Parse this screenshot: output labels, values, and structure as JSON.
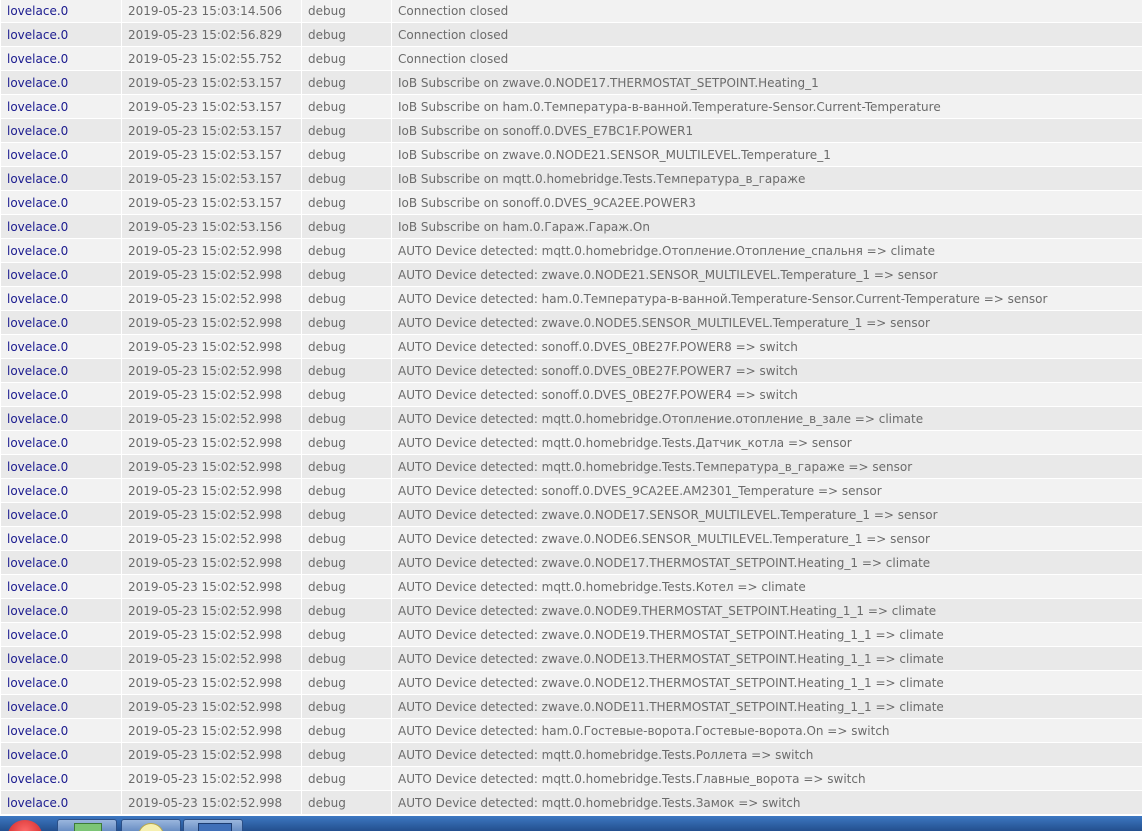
{
  "log": {
    "rows": [
      {
        "source": "lovelace.0",
        "time": "2019-05-23 15:03:14.506",
        "severity": "debug",
        "message": "Connection closed"
      },
      {
        "source": "lovelace.0",
        "time": "2019-05-23 15:02:56.829",
        "severity": "debug",
        "message": "Connection closed"
      },
      {
        "source": "lovelace.0",
        "time": "2019-05-23 15:02:55.752",
        "severity": "debug",
        "message": "Connection closed"
      },
      {
        "source": "lovelace.0",
        "time": "2019-05-23 15:02:53.157",
        "severity": "debug",
        "message": "IoB Subscribe on zwave.0.NODE17.THERMOSTAT_SETPOINT.Heating_1"
      },
      {
        "source": "lovelace.0",
        "time": "2019-05-23 15:02:53.157",
        "severity": "debug",
        "message": "IoB Subscribe on ham.0.Температура-в-ванной.Temperature-Sensor.Current-Temperature"
      },
      {
        "source": "lovelace.0",
        "time": "2019-05-23 15:02:53.157",
        "severity": "debug",
        "message": "IoB Subscribe on sonoff.0.DVES_E7BC1F.POWER1"
      },
      {
        "source": "lovelace.0",
        "time": "2019-05-23 15:02:53.157",
        "severity": "debug",
        "message": "IoB Subscribe on zwave.0.NODE21.SENSOR_MULTILEVEL.Temperature_1"
      },
      {
        "source": "lovelace.0",
        "time": "2019-05-23 15:02:53.157",
        "severity": "debug",
        "message": "IoB Subscribe on mqtt.0.homebridge.Tests.Температура_в_гараже"
      },
      {
        "source": "lovelace.0",
        "time": "2019-05-23 15:02:53.157",
        "severity": "debug",
        "message": "IoB Subscribe on sonoff.0.DVES_9CA2EE.POWER3"
      },
      {
        "source": "lovelace.0",
        "time": "2019-05-23 15:02:53.156",
        "severity": "debug",
        "message": "IoB Subscribe on ham.0.Гараж.Гараж.On"
      },
      {
        "source": "lovelace.0",
        "time": "2019-05-23 15:02:52.998",
        "severity": "debug",
        "message": "AUTO Device detected: mqtt.0.homebridge.Отопление.Отопление_спальня => climate"
      },
      {
        "source": "lovelace.0",
        "time": "2019-05-23 15:02:52.998",
        "severity": "debug",
        "message": "AUTO Device detected: zwave.0.NODE21.SENSOR_MULTILEVEL.Temperature_1 => sensor"
      },
      {
        "source": "lovelace.0",
        "time": "2019-05-23 15:02:52.998",
        "severity": "debug",
        "message": "AUTO Device detected: ham.0.Температура-в-ванной.Temperature-Sensor.Current-Temperature => sensor"
      },
      {
        "source": "lovelace.0",
        "time": "2019-05-23 15:02:52.998",
        "severity": "debug",
        "message": "AUTO Device detected: zwave.0.NODE5.SENSOR_MULTILEVEL.Temperature_1 => sensor"
      },
      {
        "source": "lovelace.0",
        "time": "2019-05-23 15:02:52.998",
        "severity": "debug",
        "message": "AUTO Device detected: sonoff.0.DVES_0BE27F.POWER8 => switch"
      },
      {
        "source": "lovelace.0",
        "time": "2019-05-23 15:02:52.998",
        "severity": "debug",
        "message": "AUTO Device detected: sonoff.0.DVES_0BE27F.POWER7 => switch"
      },
      {
        "source": "lovelace.0",
        "time": "2019-05-23 15:02:52.998",
        "severity": "debug",
        "message": "AUTO Device detected: sonoff.0.DVES_0BE27F.POWER4 => switch"
      },
      {
        "source": "lovelace.0",
        "time": "2019-05-23 15:02:52.998",
        "severity": "debug",
        "message": "AUTO Device detected: mqtt.0.homebridge.Отопление.отопление_в_зале => climate"
      },
      {
        "source": "lovelace.0",
        "time": "2019-05-23 15:02:52.998",
        "severity": "debug",
        "message": "AUTO Device detected: mqtt.0.homebridge.Tests.Датчик_котла => sensor"
      },
      {
        "source": "lovelace.0",
        "time": "2019-05-23 15:02:52.998",
        "severity": "debug",
        "message": "AUTO Device detected: mqtt.0.homebridge.Tests.Температура_в_гараже => sensor"
      },
      {
        "source": "lovelace.0",
        "time": "2019-05-23 15:02:52.998",
        "severity": "debug",
        "message": "AUTO Device detected: sonoff.0.DVES_9CA2EE.AM2301_Temperature => sensor"
      },
      {
        "source": "lovelace.0",
        "time": "2019-05-23 15:02:52.998",
        "severity": "debug",
        "message": "AUTO Device detected: zwave.0.NODE17.SENSOR_MULTILEVEL.Temperature_1 => sensor"
      },
      {
        "source": "lovelace.0",
        "time": "2019-05-23 15:02:52.998",
        "severity": "debug",
        "message": "AUTO Device detected: zwave.0.NODE6.SENSOR_MULTILEVEL.Temperature_1 => sensor"
      },
      {
        "source": "lovelace.0",
        "time": "2019-05-23 15:02:52.998",
        "severity": "debug",
        "message": "AUTO Device detected: zwave.0.NODE17.THERMOSTAT_SETPOINT.Heating_1 => climate"
      },
      {
        "source": "lovelace.0",
        "time": "2019-05-23 15:02:52.998",
        "severity": "debug",
        "message": "AUTO Device detected: mqtt.0.homebridge.Tests.Котел => climate"
      },
      {
        "source": "lovelace.0",
        "time": "2019-05-23 15:02:52.998",
        "severity": "debug",
        "message": "AUTO Device detected: zwave.0.NODE9.THERMOSTAT_SETPOINT.Heating_1_1 => climate"
      },
      {
        "source": "lovelace.0",
        "time": "2019-05-23 15:02:52.998",
        "severity": "debug",
        "message": "AUTO Device detected: zwave.0.NODE19.THERMOSTAT_SETPOINT.Heating_1_1 => climate"
      },
      {
        "source": "lovelace.0",
        "time": "2019-05-23 15:02:52.998",
        "severity": "debug",
        "message": "AUTO Device detected: zwave.0.NODE13.THERMOSTAT_SETPOINT.Heating_1_1 => climate"
      },
      {
        "source": "lovelace.0",
        "time": "2019-05-23 15:02:52.998",
        "severity": "debug",
        "message": "AUTO Device detected: zwave.0.NODE12.THERMOSTAT_SETPOINT.Heating_1_1 => climate"
      },
      {
        "source": "lovelace.0",
        "time": "2019-05-23 15:02:52.998",
        "severity": "debug",
        "message": "AUTO Device detected: zwave.0.NODE11.THERMOSTAT_SETPOINT.Heating_1_1 => climate"
      },
      {
        "source": "lovelace.0",
        "time": "2019-05-23 15:02:52.998",
        "severity": "debug",
        "message": "AUTO Device detected: ham.0.Гостевые-ворота.Гостевые-ворота.On => switch"
      },
      {
        "source": "lovelace.0",
        "time": "2019-05-23 15:02:52.998",
        "severity": "debug",
        "message": "AUTO Device detected: mqtt.0.homebridge.Tests.Роллета => switch"
      },
      {
        "source": "lovelace.0",
        "time": "2019-05-23 15:02:52.998",
        "severity": "debug",
        "message": "AUTO Device detected: mqtt.0.homebridge.Tests.Главные_ворота => switch"
      },
      {
        "source": "lovelace.0",
        "time": "2019-05-23 15:02:52.998",
        "severity": "debug",
        "message": "AUTO Device detected: mqtt.0.homebridge.Tests.Замок => switch"
      }
    ]
  },
  "taskbar": {
    "icons": [
      "start-orb-icon",
      "spreadsheet-icon",
      "sticky-note-icon",
      "network-icon"
    ]
  },
  "colors": {
    "source_text": "#1b1b8f",
    "text": "#6b6b6b",
    "row_odd": "#f2f2f2",
    "row_even": "#e9e9e9",
    "taskbar": "#3d78c2"
  }
}
